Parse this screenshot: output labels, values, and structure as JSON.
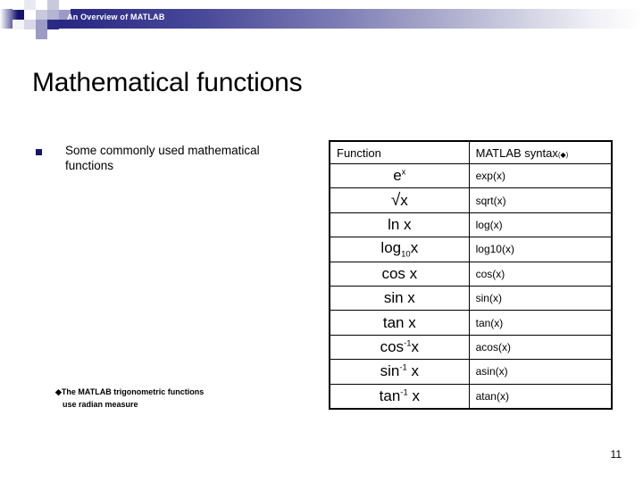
{
  "banner": {
    "title": "An Overview of MATLAB",
    "accent_dark": "#15156e",
    "accent_mid": "#9b9bc6",
    "accent_light": "#d3d3e4"
  },
  "slide": {
    "title": "Mathematical functions",
    "page_number": "11"
  },
  "bullets": [
    {
      "text": "Some commonly used mathematical functions",
      "marker": "square-bullet"
    }
  ],
  "footnote": {
    "marker": "◆",
    "line1": "The MATLAB trigonometric functions",
    "line2": "use radian measure"
  },
  "table": {
    "headers": {
      "function": "Function",
      "syntax": "MATLAB syntax",
      "syntax_marker": "(◆)"
    },
    "rows": [
      {
        "function_plain": "e^x",
        "base": "e",
        "sup": "x",
        "sub": "",
        "arg": "",
        "syntax": "exp(x)"
      },
      {
        "function_plain": "√x",
        "base": "√",
        "sup": "",
        "sub": "",
        "arg": "x",
        "syntax": "sqrt(x)"
      },
      {
        "function_plain": "ln x",
        "base": "ln",
        "sup": "",
        "sub": "",
        "arg": "x",
        "syntax": "log(x)"
      },
      {
        "function_plain": "log10 x",
        "base": "log",
        "sup": "",
        "sub": "10",
        "arg": "x",
        "syntax": "log10(x)"
      },
      {
        "function_plain": "cos x",
        "base": "cos",
        "sup": "",
        "sub": "",
        "arg": "x",
        "syntax": "cos(x)"
      },
      {
        "function_plain": "sin x",
        "base": "sin",
        "sup": "",
        "sub": "",
        "arg": "x",
        "syntax": "sin(x)"
      },
      {
        "function_plain": "tan x",
        "base": "tan",
        "sup": "",
        "sub": "",
        "arg": "x",
        "syntax": "tan(x)"
      },
      {
        "function_plain": "cos^-1 x",
        "base": "cos",
        "sup": "-1",
        "sub": "",
        "arg": "x",
        "syntax": "acos(x)"
      },
      {
        "function_plain": "sin^-1 x",
        "base": "sin",
        "sup": "-1",
        "sub": "",
        "arg": "x",
        "syntax": "asin(x)"
      },
      {
        "function_plain": "tan^-1 x",
        "base": "tan",
        "sup": "-1",
        "sub": "",
        "arg": "x",
        "syntax": "atan(x)"
      }
    ]
  }
}
